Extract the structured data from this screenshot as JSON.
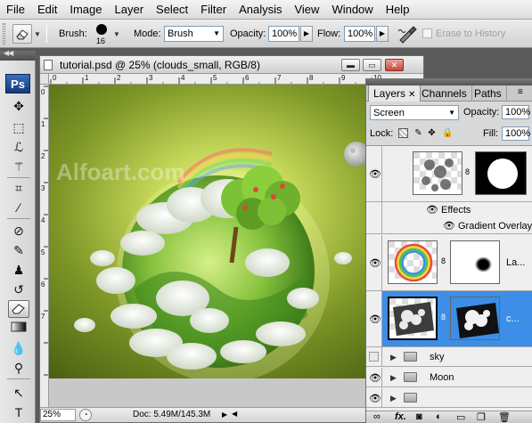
{
  "menu": [
    "File",
    "Edit",
    "Image",
    "Layer",
    "Select",
    "Filter",
    "Analysis",
    "View",
    "Window",
    "Help"
  ],
  "options": {
    "brush_label": "Brush:",
    "brush_size": "16",
    "mode_label": "Mode:",
    "mode_value": "Brush",
    "opacity_label": "Opacity:",
    "opacity_value": "100%",
    "flow_label": "Flow:",
    "flow_value": "100%",
    "erase_history": "Erase to History"
  },
  "toolbox": {
    "logo": "Ps",
    "tools": [
      "move-icon",
      "marquee-icon",
      "lasso-icon",
      "magic-wand-icon",
      "crop-icon",
      "eyedropper-icon",
      "healing-icon",
      "brush-icon",
      "stamp-icon",
      "history-brush-icon",
      "eraser-icon",
      "gradient-icon",
      "blur-icon",
      "dodge-icon",
      "path-select-icon",
      "type-icon"
    ],
    "active_tool": "eraser-icon"
  },
  "document": {
    "title": "tutorial.psd @ 25% (clouds_small, RGB/8)",
    "ruler_top": [
      "0",
      "1",
      "2",
      "3",
      "4",
      "5",
      "6",
      "7",
      "8",
      "9",
      "10"
    ],
    "ruler_left": [
      "0",
      "1",
      "2",
      "3",
      "4",
      "5",
      "6",
      "7"
    ],
    "watermark": "Alfoart.com",
    "zoom": "25%",
    "doc_size": "Doc: 5.49M/145.3M"
  },
  "layers_panel": {
    "tabs": [
      "Layers",
      "Channels",
      "Paths"
    ],
    "active_tab": "Layers",
    "blend_mode": "Screen",
    "opacity_label": "Opacity:",
    "opacity_value": "100%",
    "lock_label": "Lock:",
    "fill_label": "Fill:",
    "fill_value": "100%",
    "layers": [
      {
        "name": "",
        "type": "layer",
        "visible": true
      },
      {
        "name": "Effects",
        "type": "effects"
      },
      {
        "name": "Gradient Overlay",
        "type": "effect"
      },
      {
        "name": "La...",
        "type": "layer",
        "visible": true
      },
      {
        "name": "c...",
        "type": "layer",
        "visible": true,
        "selected": true
      },
      {
        "name": "sky",
        "type": "group",
        "visible": false
      },
      {
        "name": "Moon",
        "type": "group",
        "visible": true
      }
    ]
  },
  "colors": {
    "accent": "#3d8ee6",
    "ps_logo": "#1f4c9a",
    "canvas_bg": "#6f8a1e"
  }
}
